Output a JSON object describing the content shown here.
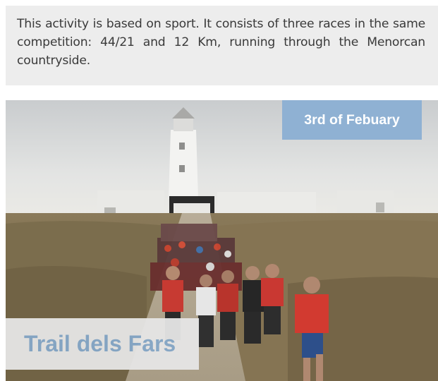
{
  "intro": {
    "text": "This activity is based on sport. It consists of three races in the same competition: 44/21 and 12 Km, running through the Menorcan countryside."
  },
  "event": {
    "date": "3rd of Febuary",
    "title": "Trail dels Fars"
  },
  "colors": {
    "intro_background": "#ededed",
    "date_badge": "#8fb1d3",
    "title_text": "#86a8c9",
    "title_badge": "#e6e6e6"
  }
}
